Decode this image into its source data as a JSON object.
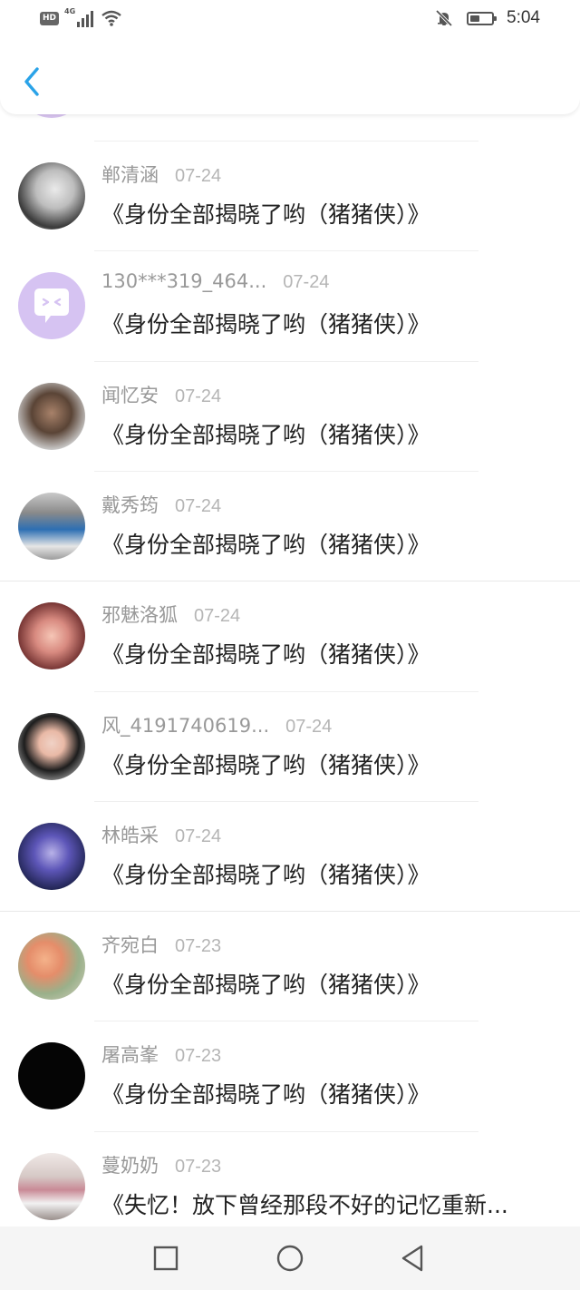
{
  "status_bar": {
    "hd": "HD",
    "network": "4G",
    "time": "5:04"
  },
  "header": {
    "back_icon": "chevron-left-icon",
    "accent_color": "#2aa3e8"
  },
  "items": [
    {
      "name": "郸清涵",
      "date": "07-24",
      "title": "《身份全部揭晓了哟（猪猪侠）》",
      "avatar": "portrait-bw"
    },
    {
      "name": "130***319_464...",
      "date": "07-24",
      "title": "《身份全部揭晓了哟（猪猪侠）》",
      "avatar": "default-chat-bubble"
    },
    {
      "name": "闻忆安",
      "date": "07-24",
      "title": "《身份全部揭晓了哟（猪猪侠）》",
      "avatar": "portrait-man"
    },
    {
      "name": "戴秀筠",
      "date": "07-24",
      "title": "《身份全部揭晓了哟（猪猪侠）》",
      "avatar": "photo-two-people"
    },
    {
      "name": "邪魅洛狐",
      "date": "07-24",
      "title": "《身份全部揭晓了哟（猪猪侠）》",
      "avatar": "anime-pink"
    },
    {
      "name": "风_4191740619...",
      "date": "07-24",
      "title": "《身份全部揭晓了哟（猪猪侠）》",
      "avatar": "portrait-woman"
    },
    {
      "name": "林皓采",
      "date": "07-24",
      "title": "《身份全部揭晓了哟（猪猪侠）》",
      "avatar": "anime-purple"
    },
    {
      "name": "齐宛白",
      "date": "07-23",
      "title": "《身份全部揭晓了哟（猪猪侠）》",
      "avatar": "flowers"
    },
    {
      "name": "屠高峯",
      "date": "07-23",
      "title": "《身份全部揭晓了哟（猪猪侠）》",
      "avatar": "black-text"
    },
    {
      "name": "蔓奶奶",
      "date": "07-23",
      "title": "《失忆！放下曾经那段不好的记忆重新...",
      "avatar": "photo-child"
    }
  ],
  "nav_bar": {
    "recents_icon": "square-icon",
    "home_icon": "circle-icon",
    "back_icon": "triangle-back-icon"
  }
}
